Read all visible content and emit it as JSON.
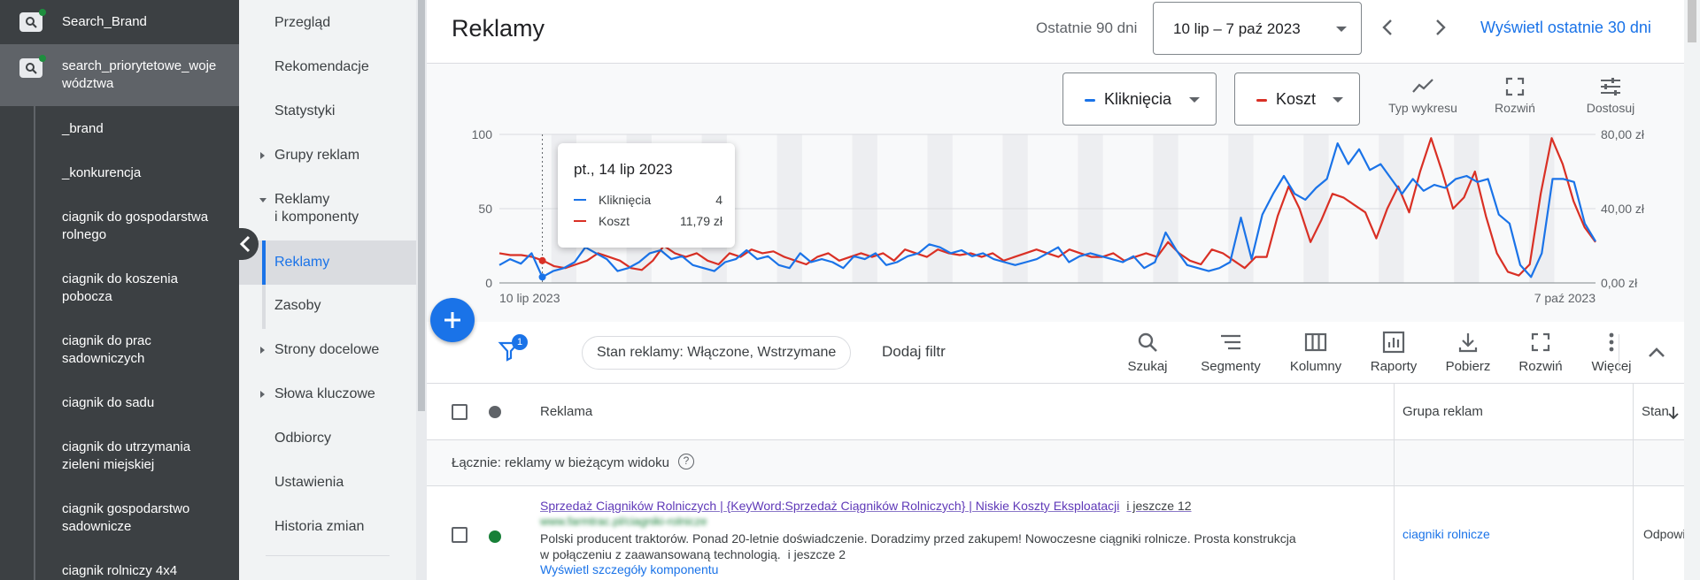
{
  "campaigns": [
    {
      "name": "Search_Brand"
    },
    {
      "name": "search_priorytetowe_województwa"
    }
  ],
  "ad_groups": [
    "_brand",
    "_konkurencja",
    "ciagnik do gospodarstwa rolnego",
    "ciagnik do koszenia pobocza",
    "ciagnik do prac sadowniczych",
    "ciagnik do sadu",
    "ciagnik do utrzymania zieleni miejskiej",
    "ciagnik gospodarstwo sadownicze",
    "ciagnik rolniczy 4x4"
  ],
  "nav": {
    "items": [
      "Przegląd",
      "Rekomendacje",
      "Statystyki",
      "Grupy reklam",
      "Reklamy\ni komponenty",
      "Reklamy",
      "Zasoby",
      "Strony docelowe",
      "Słowa kluczowe",
      "Odbiorcy",
      "Ustawienia",
      "Historia zmian"
    ]
  },
  "header": {
    "title": "Reklamy",
    "range_label": "Ostatnie 90 dni",
    "date_range": "10 lip – 7 paź 2023",
    "last30_link": "Wyświetl ostatnie 30 dni"
  },
  "chart_controls": {
    "metric1": "Kliknięcia",
    "metric2": "Koszt",
    "tools": [
      "Typ wykresu",
      "Rozwiń",
      "Dostosuj"
    ]
  },
  "tooltip": {
    "title": "pt., 14 lip 2023",
    "rows": [
      {
        "name": "Kliknięcia",
        "value": "4"
      },
      {
        "name": "Koszt",
        "value": "11,79 zł"
      }
    ]
  },
  "chart_data": {
    "type": "line",
    "x_start": "10 lip 2023",
    "x_end": "7 paź 2023",
    "left_axis": {
      "ticks": [
        "100",
        "50",
        "0"
      ],
      "range": [
        0,
        100
      ]
    },
    "right_axis": {
      "ticks": [
        "80,00 zł",
        "40,00 zł",
        "0,00 zł"
      ],
      "range": [
        0,
        80
      ]
    },
    "colors": {
      "clicks": "#1a73e8",
      "cost": "#d93025"
    },
    "series": [
      {
        "name": "Kliknięcia",
        "axis": "left",
        "values": [
          12,
          16,
          13,
          20,
          4,
          8,
          10,
          14,
          24,
          20,
          16,
          8,
          10,
          14,
          20,
          22,
          16,
          18,
          12,
          10,
          8,
          14,
          16,
          22,
          16,
          18,
          12,
          10,
          20,
          14,
          16,
          14,
          10,
          18,
          16,
          20,
          12,
          14,
          18,
          20,
          26,
          24,
          20,
          22,
          18,
          20,
          16,
          14,
          12,
          14,
          16,
          20,
          24,
          14,
          18,
          20,
          18,
          16,
          14,
          18,
          10,
          14,
          34,
          22,
          12,
          10,
          8,
          10,
          14,
          44,
          16,
          46,
          60,
          72,
          60,
          56,
          64,
          70,
          94,
          80,
          90,
          76,
          80,
          70,
          60,
          70,
          62,
          66,
          64,
          70,
          72,
          68,
          70,
          46,
          40,
          12,
          4,
          20,
          70,
          70,
          68,
          40,
          28
        ]
      },
      {
        "name": "Koszt",
        "axis": "right",
        "values": [
          16,
          15,
          15,
          14,
          12,
          9,
          8,
          10,
          12,
          16,
          14,
          12,
          8,
          7,
          12,
          20,
          16,
          14,
          16,
          12,
          10,
          16,
          14,
          18,
          16,
          17,
          14,
          12,
          10,
          14,
          16,
          12,
          14,
          16,
          14,
          16,
          12,
          18,
          16,
          14,
          18,
          16,
          15,
          16,
          14,
          16,
          12,
          14,
          16,
          18,
          16,
          14,
          18,
          16,
          14,
          14,
          16,
          12,
          14,
          16,
          14,
          22,
          16,
          12,
          10,
          18,
          16,
          12,
          8,
          14,
          14,
          36,
          52,
          40,
          22,
          34,
          48,
          46,
          42,
          38,
          24,
          40,
          52,
          38,
          60,
          78,
          60,
          40,
          46,
          60,
          36,
          16,
          6,
          4,
          10,
          48,
          78,
          64,
          44,
          30,
          22
        ]
      }
    ]
  },
  "filterbar": {
    "badge": "1",
    "chip": "Stan reklamy: Włączone, Wstrzymane",
    "add_filter": "Dodaj filtr",
    "tools": [
      "Szukaj",
      "Segmenty",
      "Kolumny",
      "Raporty",
      "Pobierz",
      "Rozwiń",
      "Więcej"
    ]
  },
  "table": {
    "columns": [
      "Reklama",
      "Grupa reklam",
      "Stan"
    ],
    "total_label": "Łącznie: reklamy w bieżącym widoku",
    "rows": [
      {
        "headline": "Sprzedaż Ciągników Rolniczych | {KeyWord:Sprzedaż Ciągników Rolniczych} | Niskie Koszty Eksploatacji",
        "headline_more": "i jeszcze 12",
        "display_url": "www.farmtrac.pl/ciagniki-rolnicze",
        "description": "Polski producent traktorów. Ponad 20-letnie doświadczenie. Doradzimy przed zakupem! Nowoczesne ciągniki rolnicze. Prosta konstrukcja w połączeniu z zaawansowaną technologią.",
        "description_more": "i jeszcze 2",
        "details_link": "Wyświetl szczegóły komponentu",
        "ad_group": "ciagniki rolnicze",
        "status": "Odpowie",
        "status_color": "#188038"
      }
    ]
  }
}
